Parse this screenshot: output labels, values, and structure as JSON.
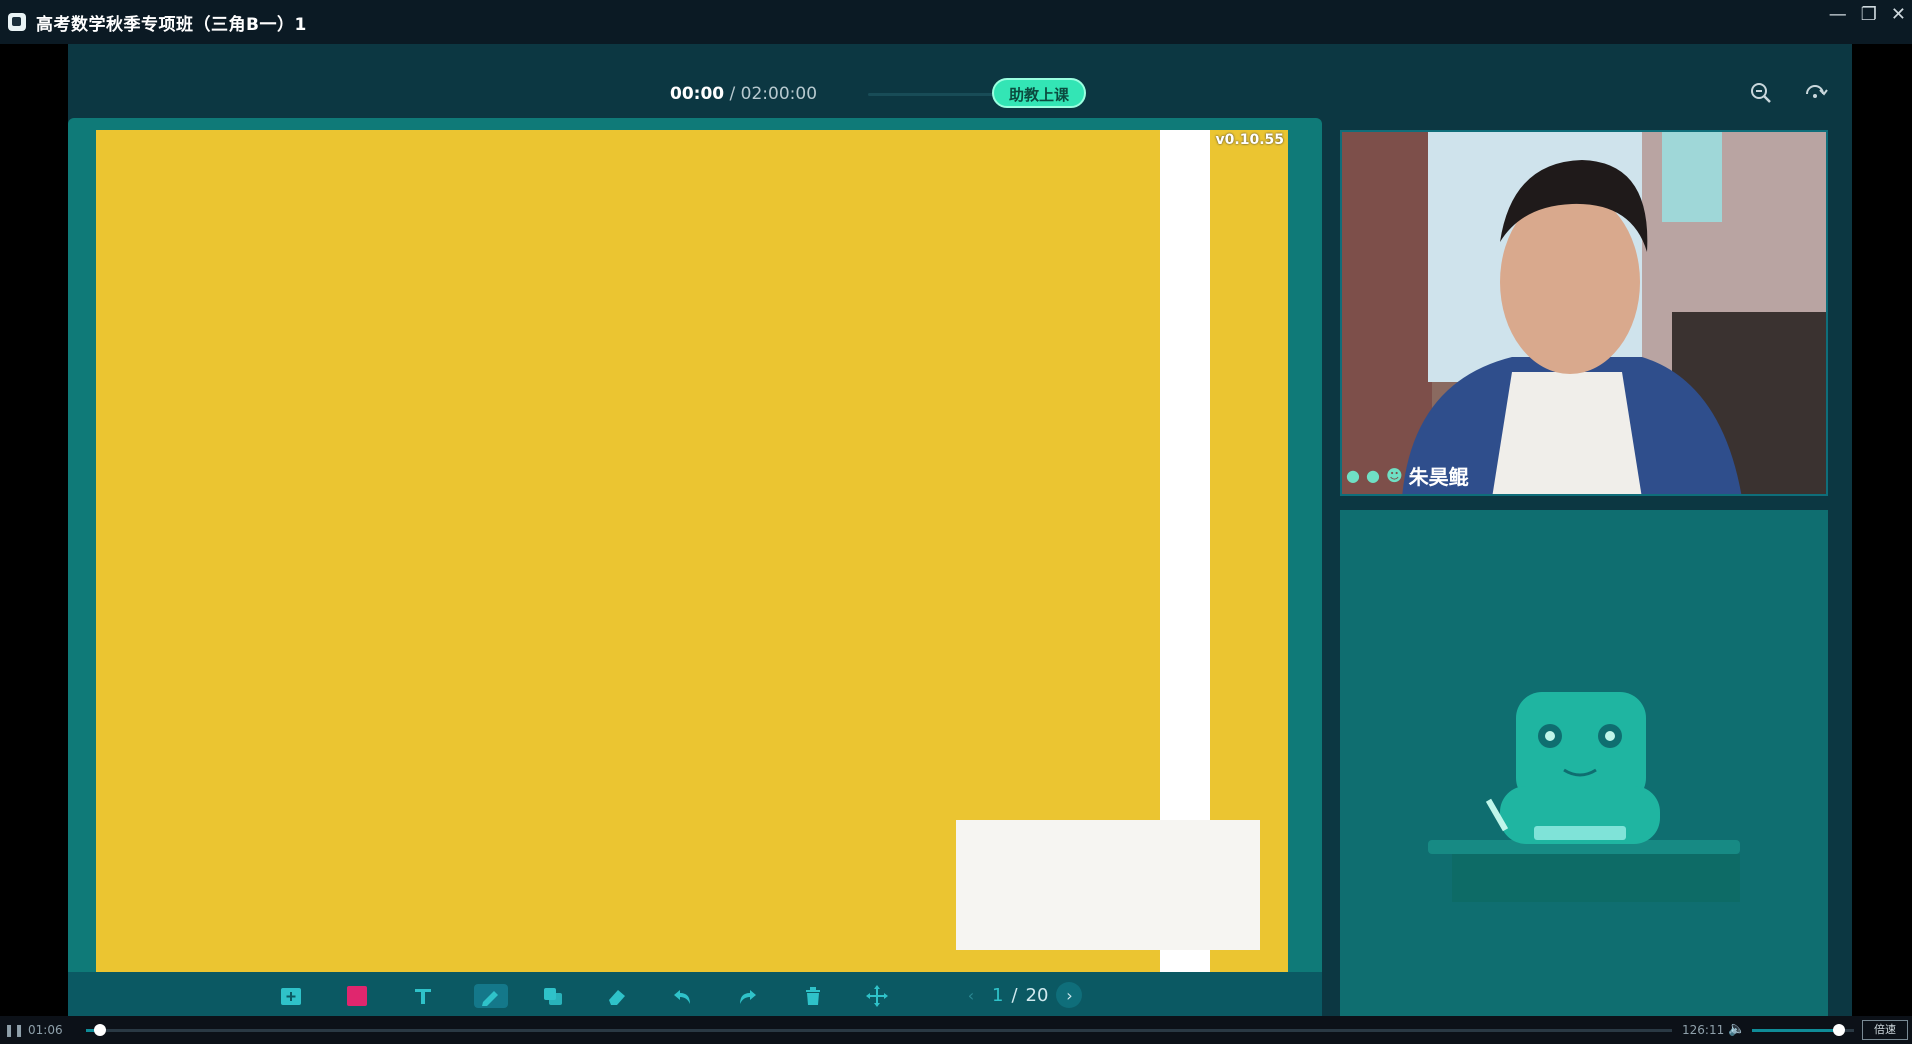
{
  "window": {
    "title": "高考数学秋季专项班（三角B一）1"
  },
  "header": {
    "time_current": "00:00",
    "time_separator": " / ",
    "time_total": "02:00:00",
    "assist_button": "助教上课"
  },
  "board": {
    "version": "v0.10.55"
  },
  "pager": {
    "current": "1",
    "separator": " / ",
    "total": "20"
  },
  "teacher": {
    "name": "朱昊鲲"
  },
  "player": {
    "elapsed": "01:06",
    "duration": "126:11",
    "progress": 0.009,
    "volume": 0.85,
    "speed_label": "倍速"
  },
  "icons": {
    "toolbar": [
      "new-page-icon",
      "color-swatch-icon",
      "text-tool-icon",
      "brush-tool-icon",
      "shape-tool-icon",
      "eraser-icon",
      "undo-icon",
      "redo-icon",
      "delete-icon",
      "move-icon"
    ],
    "top": [
      "zoom-icon",
      "refresh-icon"
    ]
  },
  "colors": {
    "accent": "#33e5b5",
    "slide_bg": "#ebc531",
    "panel": "#0f7a78",
    "swatch": "#e0266e"
  }
}
